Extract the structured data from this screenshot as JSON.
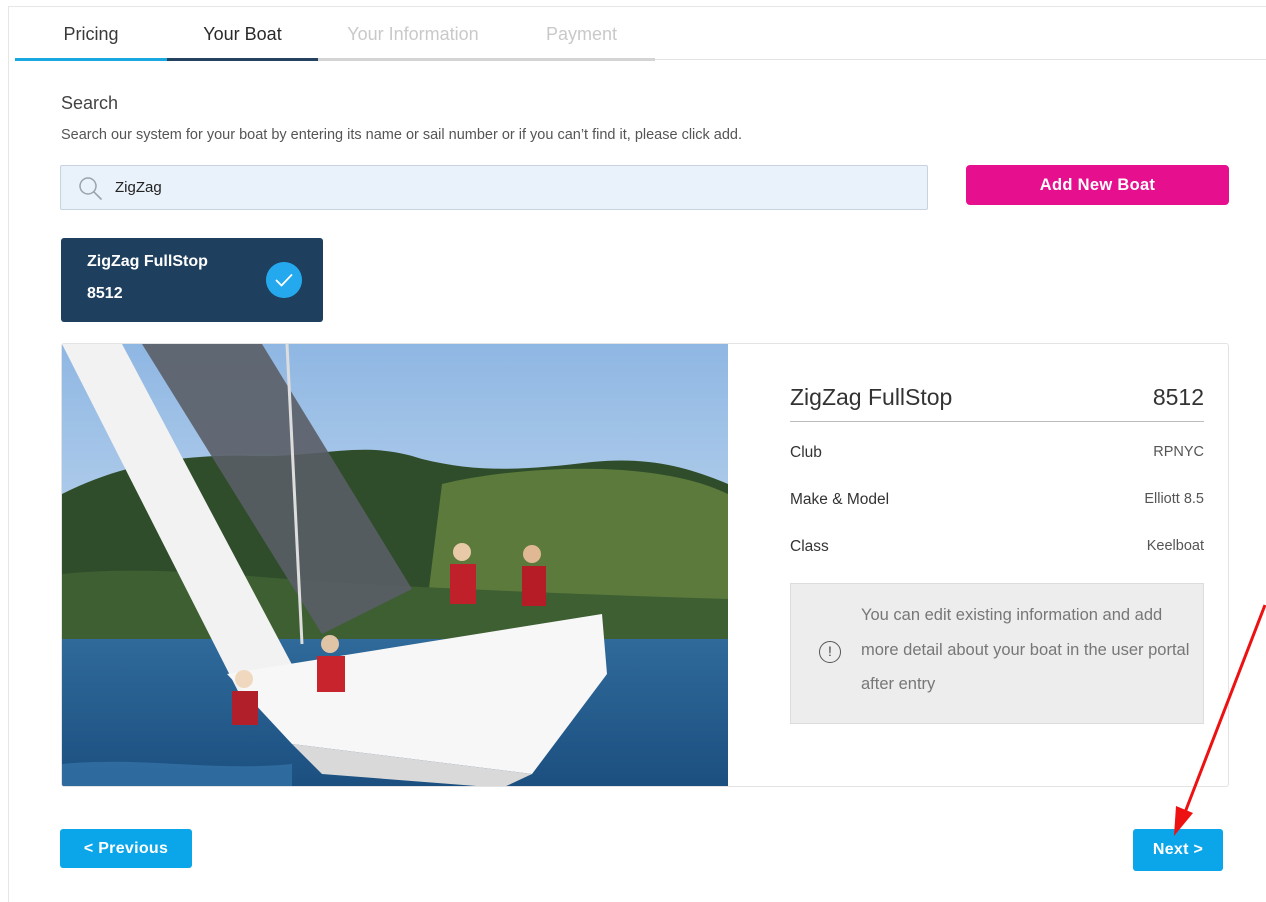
{
  "tabs": [
    {
      "label": "Pricing",
      "state": "completed"
    },
    {
      "label": "Your Boat",
      "state": "active"
    },
    {
      "label": "Your Information",
      "state": "disabled"
    },
    {
      "label": "Payment",
      "state": "disabled"
    }
  ],
  "search": {
    "title": "Search",
    "help": "Search our system for your boat by entering its name or sail number or if you can’t find it, please click add.",
    "value": "ZigZag"
  },
  "add_button": "Add New Boat",
  "result": {
    "name": "ZigZag FullStop",
    "number": "8512",
    "selected": true
  },
  "boat": {
    "name": "ZigZag FullStop",
    "number": "8512",
    "fields": [
      {
        "label": "Club",
        "value": "RPNYC"
      },
      {
        "label": "Make & Model",
        "value": "Elliott 8.5"
      },
      {
        "label": "Class",
        "value": "Keelboat"
      }
    ],
    "note": "You can edit existing information and add more detail about your boat in the user portal after entry"
  },
  "nav": {
    "previous": "< Previous",
    "next": "Next >"
  },
  "colors": {
    "accent_blue": "#0ba6ea",
    "brand_pink": "#e6108f",
    "navy": "#1f3f5e",
    "annotation_red": "#ee1111"
  },
  "icons": {
    "search": "search-icon",
    "check": "check-circle-icon",
    "info": "info-circle-icon",
    "annotation": "red-arrow-icon"
  }
}
